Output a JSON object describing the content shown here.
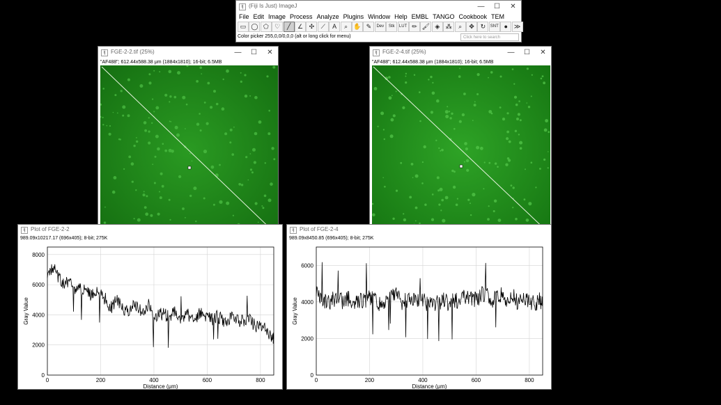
{
  "imagej": {
    "title": "(Fiji Is Just) ImageJ",
    "menus": [
      "File",
      "Edit",
      "Image",
      "Process",
      "Analyze",
      "Plugins",
      "Window",
      "Help",
      "EMBL",
      "TANGO",
      "Cookbook",
      "TEM"
    ],
    "tools": [
      {
        "name": "rectangle-tool",
        "glyph": "▭"
      },
      {
        "name": "oval-tool",
        "glyph": "◯"
      },
      {
        "name": "polygon-tool",
        "glyph": "⬠"
      },
      {
        "name": "freehand-tool",
        "glyph": "♡"
      },
      {
        "name": "line-tool",
        "glyph": "╱"
      },
      {
        "name": "angle-tool",
        "glyph": "∠"
      },
      {
        "name": "point-tool",
        "glyph": "✣"
      },
      {
        "name": "wand-tool",
        "glyph": "⟋"
      },
      {
        "name": "text-tool",
        "glyph": "A"
      },
      {
        "name": "magnifier-tool",
        "glyph": "⌕"
      },
      {
        "name": "hand-tool",
        "glyph": "✋"
      },
      {
        "name": "color-picker-tool",
        "glyph": "✎"
      },
      {
        "name": "dev-tool",
        "glyph": "Dev"
      },
      {
        "name": "stk-tool",
        "glyph": "Stk"
      },
      {
        "name": "lut-tool",
        "glyph": "LUT"
      },
      {
        "name": "pencil-tool",
        "glyph": "✏"
      },
      {
        "name": "brush-tool",
        "glyph": "🖌"
      },
      {
        "name": "flood-fill-tool",
        "glyph": "◈"
      },
      {
        "name": "spray-tool",
        "glyph": "⁂"
      },
      {
        "name": "zoom-search-tool",
        "glyph": "⌕"
      },
      {
        "name": "move-tool",
        "glyph": "✥"
      },
      {
        "name": "rotate-tool",
        "glyph": "↻"
      },
      {
        "name": "snt-tool",
        "glyph": "SNT"
      },
      {
        "name": "record-tool",
        "glyph": "●"
      },
      {
        "name": "more-tools",
        "glyph": "≫"
      }
    ],
    "status": "Color picker 255,0,0/0,0,0 (alt or long click for menu)",
    "search_placeholder": "Click here to search"
  },
  "image1": {
    "title": "FGE-2-2.tif (25%)",
    "info": "\"AF488\"; 612.44x588.38 μm (1884x1810); 16-bit; 6.5MB"
  },
  "image2": {
    "title": "FGE-2-4.tif (25%)",
    "info": "\"AF488\"; 612.44x588.38 μm (1884x1810); 16-bit; 6.5MB"
  },
  "plot1": {
    "title": "Plot of FGE-2-2",
    "info": "989.09x10217.17  (696x405); 8-bit; 275K",
    "xlabel": "Distance (μm)",
    "ylabel": "Gray Value"
  },
  "plot2": {
    "title": "Plot of FGE-2-4",
    "info": "989.09x8450.85  (696x405); 8-bit; 275K",
    "xlabel": "Distance (μm)",
    "ylabel": "Gray Value"
  },
  "chart_data": [
    {
      "type": "line",
      "xlabel": "Distance (μm)",
      "ylabel": "Gray Value",
      "xlim": [
        0,
        850
      ],
      "ylim": [
        0,
        8500
      ],
      "xticks": [
        0,
        200,
        400,
        600,
        800
      ],
      "yticks": [
        0,
        2000,
        4000,
        6000,
        8000
      ],
      "grid": true,
      "x": [
        0,
        20,
        40,
        60,
        80,
        100,
        120,
        140,
        160,
        180,
        200,
        220,
        240,
        260,
        280,
        300,
        320,
        340,
        360,
        380,
        400,
        420,
        440,
        460,
        480,
        500,
        520,
        540,
        560,
        580,
        600,
        620,
        640,
        660,
        680,
        700,
        720,
        740,
        760,
        780,
        800,
        820,
        840,
        850
      ],
      "values": [
        6800,
        7200,
        6500,
        6000,
        6300,
        5800,
        5900,
        5600,
        5300,
        5500,
        5400,
        5000,
        4500,
        5000,
        4400,
        4200,
        4600,
        4400,
        4100,
        4600,
        3800,
        4100,
        4000,
        3900,
        4200,
        3700,
        4100,
        3800,
        3900,
        4200,
        3800,
        3700,
        3900,
        3600,
        3700,
        3800,
        3500,
        3600,
        3600,
        3300,
        3200,
        3000,
        2600,
        2400
      ]
    },
    {
      "type": "line",
      "xlabel": "Distance (μm)",
      "ylabel": "Gray Value",
      "xlim": [
        0,
        850
      ],
      "ylim": [
        0,
        7000
      ],
      "xticks": [
        0,
        200,
        400,
        600,
        800
      ],
      "yticks": [
        0,
        2000,
        4000,
        6000
      ],
      "grid": true,
      "x": [
        0,
        20,
        40,
        60,
        80,
        100,
        120,
        140,
        160,
        180,
        200,
        220,
        240,
        260,
        280,
        300,
        320,
        340,
        360,
        380,
        400,
        420,
        440,
        460,
        480,
        500,
        520,
        540,
        560,
        580,
        600,
        620,
        640,
        660,
        680,
        700,
        720,
        740,
        760,
        780,
        800,
        820,
        840,
        850
      ],
      "values": [
        4500,
        4200,
        3900,
        4100,
        4300,
        4000,
        4200,
        3900,
        4100,
        4000,
        4200,
        4400,
        3800,
        3900,
        4200,
        4400,
        4000,
        4100,
        4200,
        4000,
        4100,
        3900,
        3800,
        4000,
        4100,
        3900,
        4100,
        4000,
        4300,
        4200,
        4100,
        4400,
        4500,
        4000,
        4300,
        4400,
        4100,
        4300,
        3900,
        4200,
        4000,
        3900,
        4100,
        3900
      ]
    }
  ]
}
